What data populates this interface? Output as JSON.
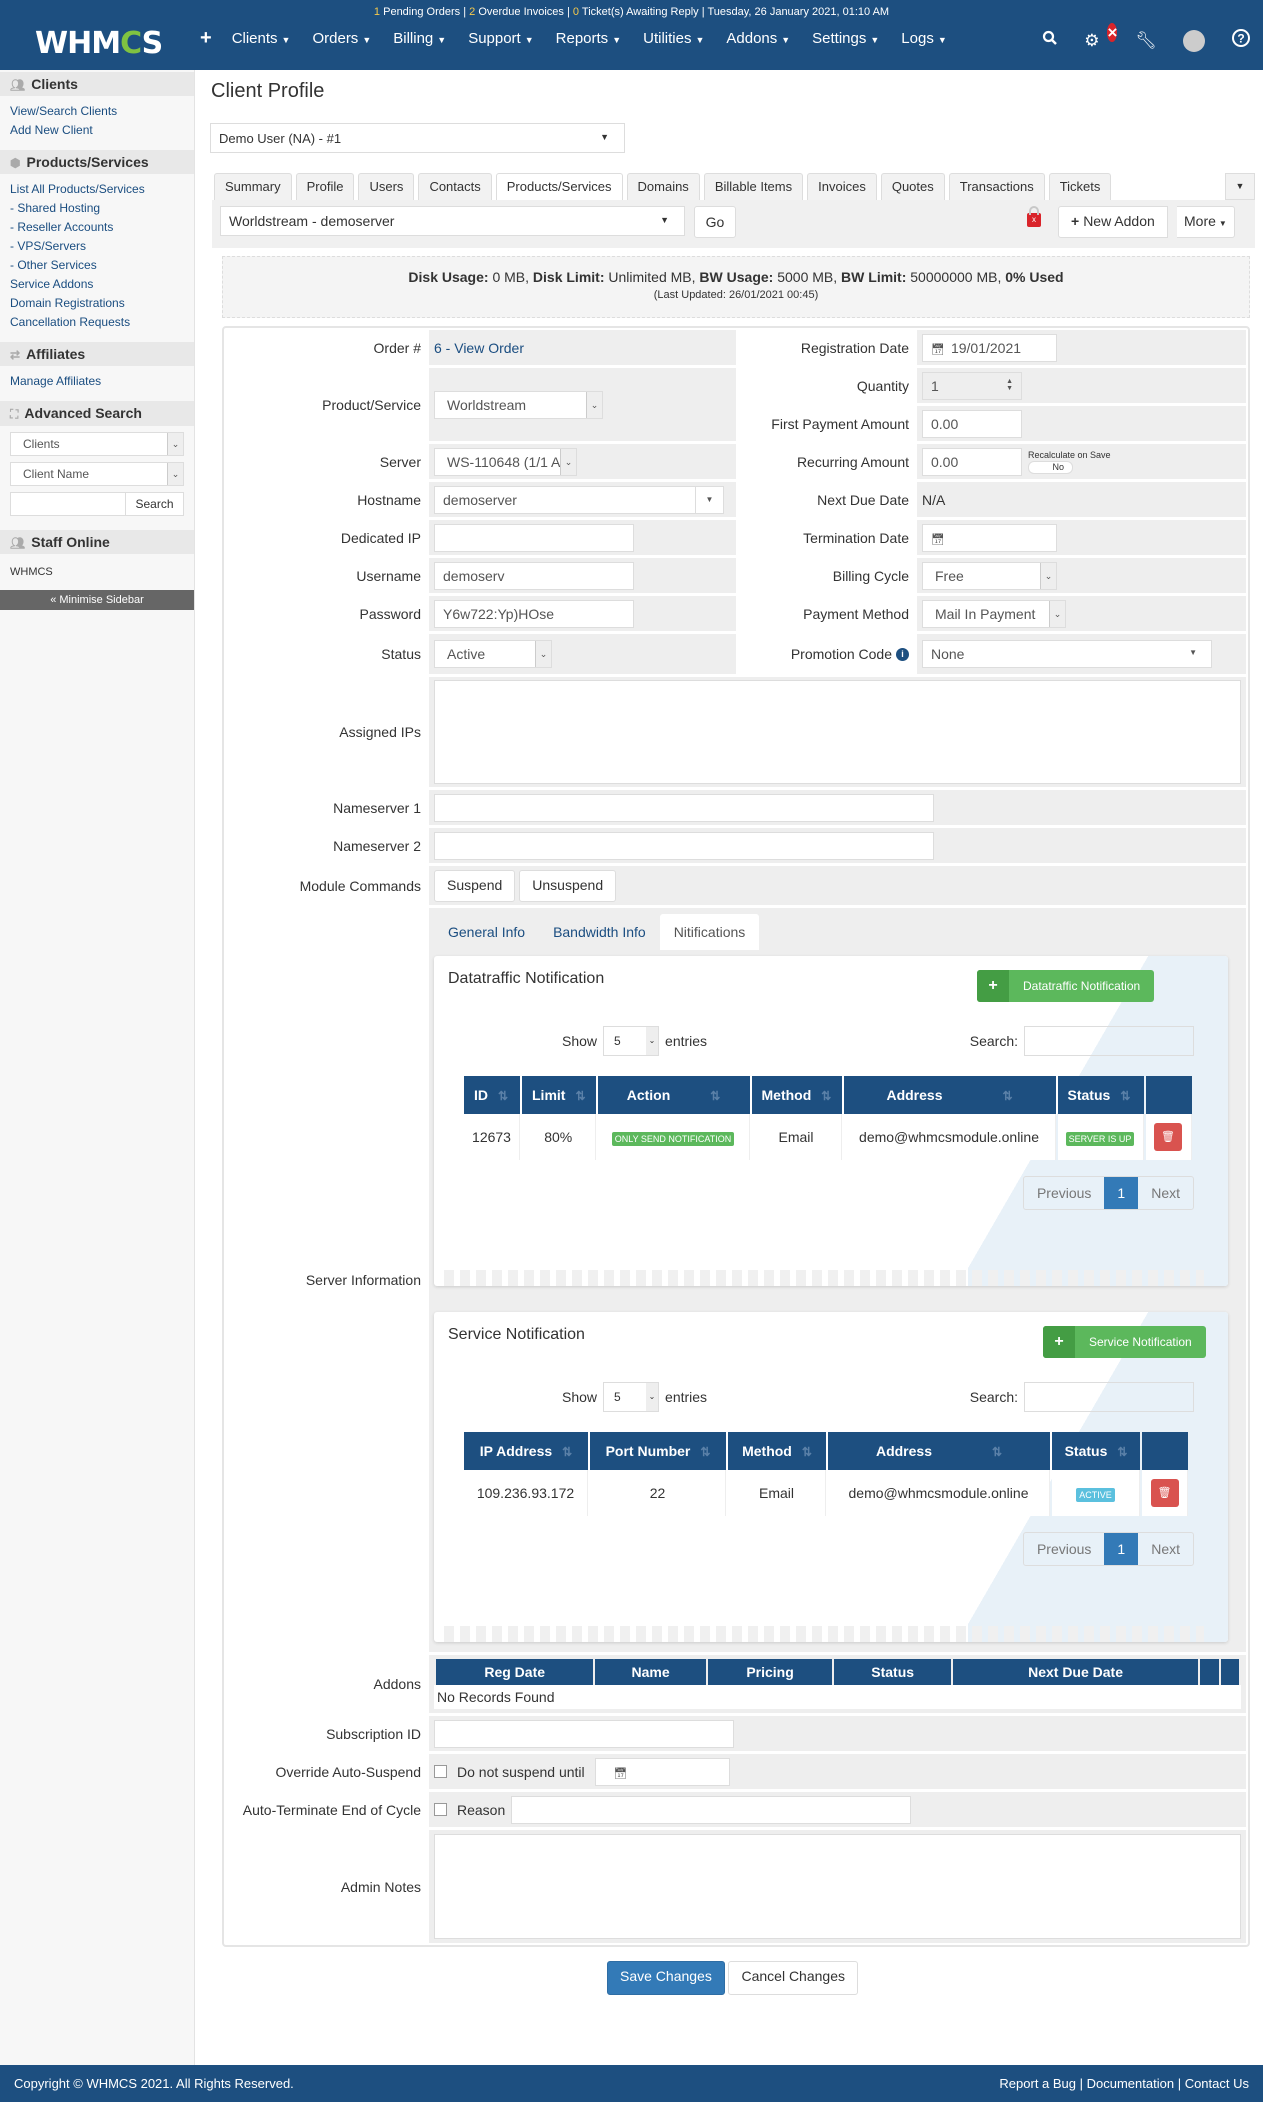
{
  "topbar": {
    "alerts": {
      "pending_orders_count": "1",
      "pending_orders_label": "Pending Orders",
      "overdue_invoices_count": "2",
      "overdue_invoices_label": "Overdue Invoices",
      "tickets_count": "0",
      "tickets_label": "Ticket(s) Awaiting Reply",
      "datetime": "Tuesday, 26 January 2021, 01:10 AM"
    },
    "logo": {
      "prefix": "WHM",
      "gear": "C",
      "suffix": "S"
    },
    "nav": [
      "Clients",
      "Orders",
      "Billing",
      "Support",
      "Reports",
      "Utilities",
      "Addons",
      "Settings",
      "Logs"
    ],
    "icons": [
      "search-icon",
      "automation-gears-icon",
      "wrench-icon",
      "user-avatar",
      "help-icon"
    ]
  },
  "sidebar": {
    "clients": {
      "title": "Clients",
      "links": [
        "View/Search Clients",
        "Add New Client"
      ]
    },
    "products": {
      "title": "Products/Services",
      "links": [
        "List All Products/Services",
        "- Shared Hosting",
        "- Reseller Accounts",
        "- VPS/Servers",
        "- Other Services",
        "Service Addons",
        "Domain Registrations",
        "Cancellation Requests"
      ]
    },
    "affiliates": {
      "title": "Affiliates",
      "links": [
        "Manage Affiliates"
      ]
    },
    "advanced_search": {
      "title": "Advanced Search",
      "type_value": "Clients",
      "field_value": "Client Name",
      "search_button": "Search"
    },
    "staff_online": {
      "title": "Staff Online",
      "users": [
        "WHMCS"
      ]
    },
    "minimise": "« Minimise Sidebar"
  },
  "page": {
    "title": "Client Profile",
    "client_select": "Demo User (NA) - #1",
    "tabs": [
      "Summary",
      "Profile",
      "Users",
      "Contacts",
      "Products/Services",
      "Domains",
      "Billable Items",
      "Invoices",
      "Quotes",
      "Transactions",
      "Tickets"
    ],
    "active_tab": "Products/Services",
    "service_select": "Worldstream - demoserver",
    "go_button": "Go",
    "new_addon_button": "New Addon",
    "more_button": "More"
  },
  "usage": {
    "disk_usage_label": "Disk Usage:",
    "disk_usage": "0 MB,",
    "disk_limit_label": "Disk Limit:",
    "disk_limit": "Unlimited MB,",
    "bw_usage_label": "BW Usage:",
    "bw_usage": "5000 MB,",
    "bw_limit_label": "BW Limit:",
    "bw_limit": "50000000 MB,",
    "percent_used": "0% Used",
    "last_updated": "(Last Updated: 26/01/2021 00:45)"
  },
  "form": {
    "order_label": "Order #",
    "order_value": "6 - View Order",
    "product_label": "Product/Service",
    "product_value": "Worldstream",
    "server_label": "Server",
    "server_value": "WS-110648 (1/1 A",
    "hostname_label": "Hostname",
    "hostname_value": "demoserver",
    "dedicated_ip_label": "Dedicated IP",
    "dedicated_ip_value": "",
    "username_label": "Username",
    "username_value": "demoserv",
    "password_label": "Password",
    "password_value": "Y6w722:Yp)HOse",
    "status_label": "Status",
    "status_value": "Active",
    "reg_date_label": "Registration Date",
    "reg_date_value": "19/01/2021",
    "quantity_label": "Quantity",
    "quantity_value": "1",
    "first_payment_label": "First Payment Amount",
    "first_payment_value": "0.00",
    "recurring_label": "Recurring Amount",
    "recurring_value": "0.00",
    "recalculate_label": "Recalculate on Save",
    "recalculate_value": "No",
    "next_due_label": "Next Due Date",
    "next_due_value": "N/A",
    "termination_label": "Termination Date",
    "termination_value": "",
    "billing_cycle_label": "Billing Cycle",
    "billing_cycle_value": "Free",
    "payment_method_label": "Payment Method",
    "payment_method_value": "Mail In Payment",
    "promo_label": "Promotion Code",
    "promo_value": "None",
    "assigned_ips_label": "Assigned IPs",
    "ns1_label": "Nameserver 1",
    "ns2_label": "Nameserver 2",
    "module_commands_label": "Module Commands",
    "suspend_button": "Suspend",
    "unsuspend_button": "Unsuspend",
    "server_info_label": "Server Information",
    "addons_label": "Addons",
    "subscription_label": "Subscription ID",
    "override_label": "Override Auto-Suspend",
    "override_check": "Do not suspend until",
    "autoterm_label": "Auto-Terminate End of Cycle",
    "autoterm_check": "Reason",
    "admin_notes_label": "Admin Notes"
  },
  "server_info": {
    "tabs": [
      "General Info",
      "Bandwidth Info",
      "Nitifications"
    ],
    "active_tab": "Nitifications",
    "datatraffic": {
      "title": "Datatraffic Notification",
      "add_button": "Datatraffic Notification",
      "show_label": "Show",
      "entries_value": "5",
      "entries_label": "entries",
      "search_label": "Search:",
      "columns": [
        "ID",
        "Limit",
        "Action",
        "Method",
        "Address",
        "Status",
        ""
      ],
      "rows": [
        {
          "id": "12673",
          "limit": "80%",
          "action": "ONLY SEND NOTIFICATION",
          "method": "Email",
          "address": "demo@whmcsmodule.online",
          "status": "SERVER IS UP"
        }
      ],
      "pager": {
        "prev": "Previous",
        "current": "1",
        "next": "Next"
      }
    },
    "service": {
      "title": "Service Notification",
      "add_button": "Service Notification",
      "show_label": "Show",
      "entries_value": "5",
      "entries_label": "entries",
      "search_label": "Search:",
      "columns": [
        "IP Address",
        "Port Number",
        "Method",
        "Address",
        "Status",
        ""
      ],
      "rows": [
        {
          "ip": "109.236.93.172",
          "port": "22",
          "method": "Email",
          "address": "demo@whmcsmodule.online",
          "status": "ACTIVE"
        }
      ],
      "pager": {
        "prev": "Previous",
        "current": "1",
        "next": "Next"
      }
    }
  },
  "addons": {
    "columns": [
      "Reg Date",
      "Name",
      "Pricing",
      "Status",
      "Next Due Date",
      "",
      ""
    ],
    "empty": "No Records Found"
  },
  "actions": {
    "save": "Save Changes",
    "cancel": "Cancel Changes"
  },
  "footer": {
    "copyright": "Copyright © WHMCS 2021. All Rights Reserved.",
    "links": [
      "Report a Bug",
      "Documentation",
      "Contact Us"
    ]
  },
  "colors": {
    "brand": "#1d4f80",
    "success": "#5cb85c",
    "danger": "#d9534f",
    "info": "#5bc0de",
    "primary": "#337ab7"
  }
}
